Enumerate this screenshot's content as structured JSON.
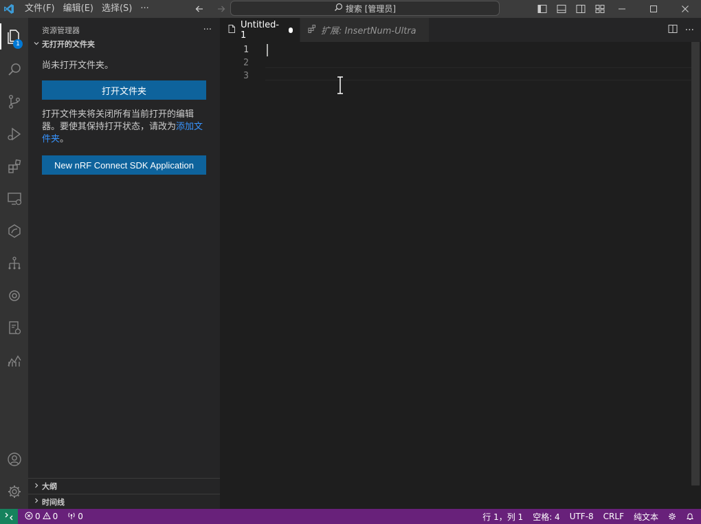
{
  "menu": [
    "文件(F)",
    "编辑(E)",
    "选择(S)",
    "···"
  ],
  "search": {
    "label": "搜索 [管理员]"
  },
  "activity": {
    "explorer_badge": "1"
  },
  "sidebar": {
    "title": "资源管理器",
    "more": "···",
    "section_title": "无打开的文件夹",
    "no_folder_text": "尚未打开文件夹。",
    "open_folder_button": "打开文件夹",
    "desc_text": "打开文件夹将关闭所有当前打开的编辑器。要使其保持打开状态，请改为",
    "desc_link": "添加文件夹",
    "desc_end": "。",
    "nrf_button": "New nRF Connect SDK Application",
    "outline": "大纲",
    "timeline": "时间线"
  },
  "editor": {
    "tabs": [
      {
        "label": "Untitled-1"
      },
      {
        "label": "扩展: InsertNum-Ultra"
      }
    ],
    "line_numbers": [
      "1",
      "2",
      "3"
    ]
  },
  "status": {
    "errors": "0",
    "warnings": "0",
    "ports": "0",
    "position": "行 1，列 1",
    "spaces": "空格: 4",
    "encoding": "UTF-8",
    "eol": "CRLF",
    "language": "纯文本"
  },
  "colors": {
    "statusbar": "#68217a",
    "remote": "#16825d",
    "button": "#0e639c",
    "link": "#3794ff"
  }
}
